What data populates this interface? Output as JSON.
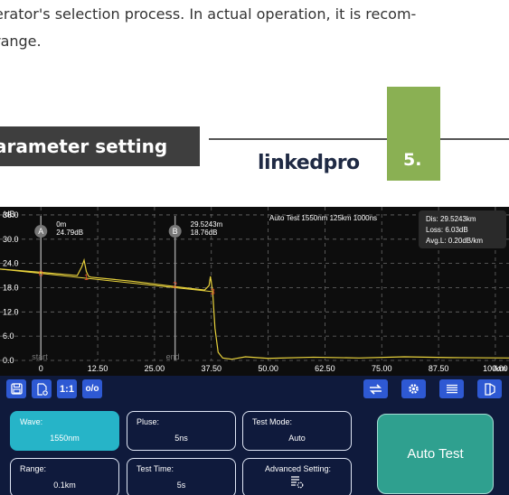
{
  "manual": {
    "intro_line1": "erator's selection process. In actual operation, it is recom-",
    "intro_line2": "range.",
    "section_title": "arameter setting",
    "logo": "linkedpro",
    "section_number": "5."
  },
  "chart_data": {
    "type": "line",
    "ylabel": "/dB",
    "xlabel": "/km",
    "y_ticks": [
      "36.0",
      "30.0",
      "24.0",
      "18.0",
      "12.0",
      "6.0",
      "0.0"
    ],
    "x_ticks": [
      "0",
      "12.50",
      "25.00",
      "37.50",
      "50.00",
      "62.50",
      "75.00",
      "87.50",
      "100.00"
    ],
    "ylim": [
      0,
      38
    ],
    "xlim": [
      -9,
      103
    ],
    "grid": true,
    "trace": {
      "x": [
        -9,
        0,
        8,
        9,
        9.5,
        10,
        10.5,
        11,
        12,
        20,
        30,
        36,
        37,
        37.3,
        37.8,
        38.3,
        39,
        40,
        42,
        45,
        50,
        60,
        70,
        80,
        90,
        103
      ],
      "y": [
        22.6,
        21.8,
        21.0,
        23.2,
        24.8,
        22.0,
        20.8,
        20.6,
        20.5,
        19.6,
        18.2,
        17.4,
        18.5,
        20.8,
        17.0,
        8.0,
        2.0,
        0.6,
        0.3,
        0.9,
        0.5,
        0.8,
        0.6,
        0.9,
        0.7,
        0.6
      ]
    },
    "fit_line": {
      "x": [
        -9,
        38
      ],
      "y": [
        22.6,
        17.0
      ]
    },
    "cursors": [
      {
        "label": "A",
        "x": 0,
        "dist": "0m",
        "loss": "24.79dB",
        "footer": "start"
      },
      {
        "label": "B",
        "x": 29.5243,
        "dist": "29.5243m",
        "loss": "18.76dB",
        "footer": "end"
      }
    ],
    "event_markers": [
      {
        "label": "0",
        "x": 0,
        "y": 21.5
      },
      {
        "label": "1",
        "x": 10,
        "y": 20.6
      },
      {
        "label": "2",
        "x": 29.5,
        "y": 18.7
      },
      {
        "label": "3",
        "x": 37.8,
        "y": 17.0
      }
    ],
    "header_text": "Auto Test  1550nm   125km 1000ns",
    "info_box": [
      "Dis: 29.5243km",
      "Loss: 6.03dB",
      "Avg.L: 0.20dB/km"
    ],
    "colors": {
      "trace": "#e8d23c",
      "fit": "#e8d23c",
      "grid": "#6a6a6a",
      "axis_text": "#ffffff",
      "marker": "#e04a2a",
      "cursor": "#9a9a9a",
      "info_bg": "#2a2a2a"
    }
  },
  "toolbar": {
    "save_icon": "floppy-disk-icon",
    "file_icon": "file-settings-icon",
    "ratio_label": "1:1",
    "oo_label": "o/o",
    "swap_icon": "swap-arrows-icon",
    "gear_icon": "gear-icon",
    "list_icon": "list-icon",
    "exit_icon": "exit-door-icon"
  },
  "params": {
    "wave": {
      "label": "Wave:",
      "value": "1550nm"
    },
    "pluse": {
      "label": "Pluse:",
      "value": "5ns"
    },
    "test_mode": {
      "label": "Test Mode:",
      "value": "Auto"
    },
    "range": {
      "label": "Range:",
      "value": "0.1km"
    },
    "test_time": {
      "label": "Test Time:",
      "value": "5s"
    },
    "advanced": {
      "label": "Advanced Setting:",
      "icon": "advanced-settings-icon"
    }
  },
  "auto_test_label": "Auto Test"
}
